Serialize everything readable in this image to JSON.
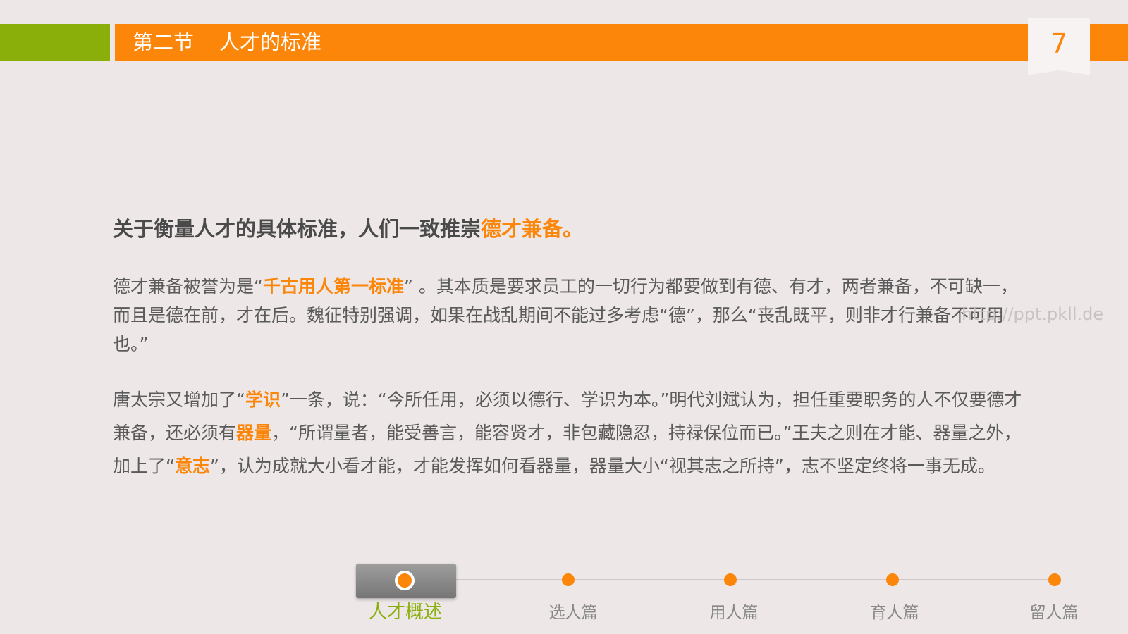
{
  "header": {
    "section": "第二节",
    "title": "人才的标准",
    "page_number": "7",
    "accent_green": "#8aaf0a",
    "accent_orange": "#fb8609"
  },
  "lead": {
    "text": "关于衡量人才的具体标准，人们一致推崇",
    "highlight": "德才兼备。"
  },
  "paragraph1": {
    "a": "德才兼备被誉为是“",
    "hl1": "千古用人第一标准",
    "b": "” 。其本质是要求员工的一切行为都要做到有德、有才，两者兼备，不可缺一，而且是德在前，才在后。魏征特别强调，如果在战乱期间不能过多考虑“德”，那么“丧乱既平，则非才行兼备不可用也。”"
  },
  "paragraph2": {
    "a": "唐太宗又增加了“",
    "hl1": "学识",
    "b": "”一条，说：“今所任用，必须以德行、学识为本。”明代刘斌认为，担任重要职务的人不仅要德才兼备，还必须有",
    "hl2": "器量",
    "c": "，“所谓量者，能受善言，能容贤才，非包藏隐忍，持禄保位而已。”王夫之则在才能、器量之外，加上了“",
    "hl3": "意志",
    "d": "”，认为成就大小看才能，才能发挥如何看器量，器量大小“视其志之所持”，志不坚定终将一事无成。"
  },
  "watermark": "http://ppt.pkll.de",
  "timeline": {
    "items": [
      "人才概述",
      "选人篇",
      "用人篇",
      "育人篇",
      "留人篇"
    ],
    "active_index": 0
  }
}
